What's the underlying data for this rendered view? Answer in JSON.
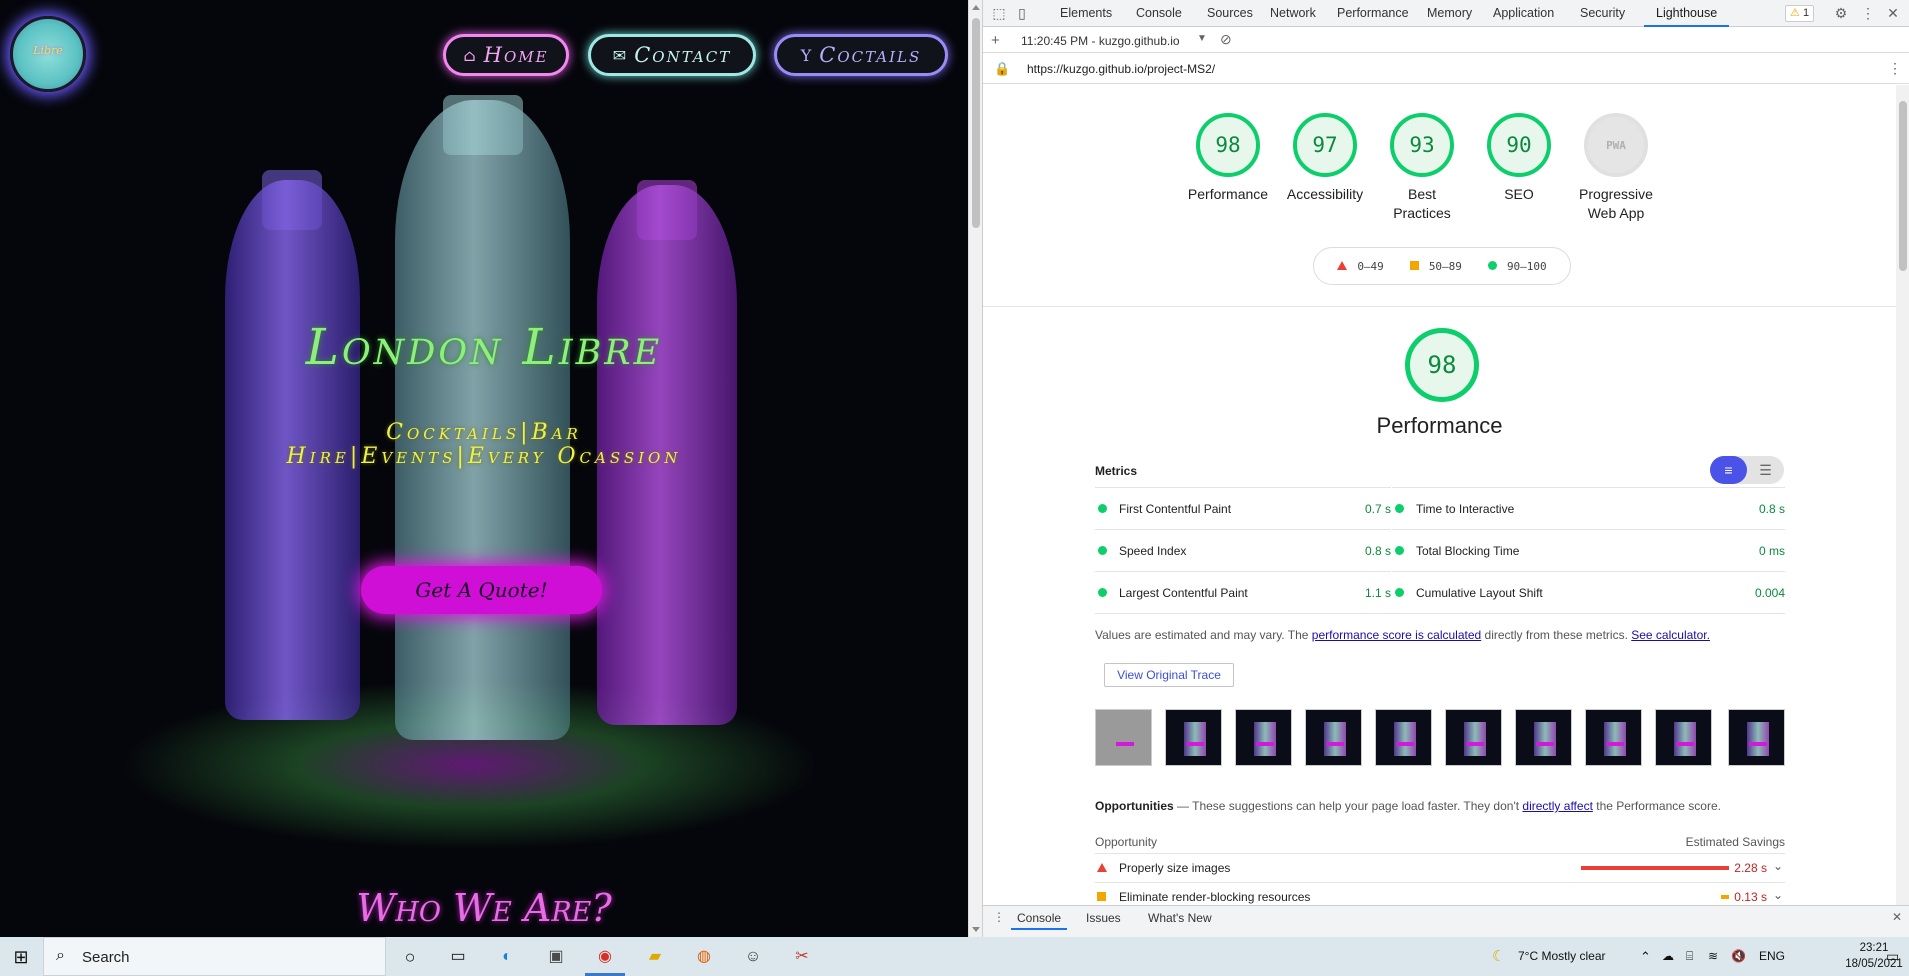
{
  "site": {
    "logo_text": "Libre",
    "nav": [
      {
        "icon": "home-icon",
        "label": "Home"
      },
      {
        "icon": "envelope-icon",
        "label": "Contact"
      },
      {
        "icon": "cocktail-icon",
        "label": "Coctails"
      }
    ],
    "hero_title": "London Libre",
    "hero_sub1": "Cocktails|Bar",
    "hero_sub2": "Hire|Events|Every Ocassion",
    "quote_button": "Get A Quote!",
    "section_title": "Who We Are?"
  },
  "devtools": {
    "tabs": [
      "Elements",
      "Console",
      "Sources",
      "Network",
      "Performance",
      "Memory",
      "Application",
      "Security",
      "Lighthouse"
    ],
    "active_tab": "Lighthouse",
    "warning_count": "1",
    "report_time": "11:20:45 PM - kuzgo.github.io",
    "url": "https://kuzgo.github.io/project-MS2/",
    "drawer_tabs": [
      "Console",
      "Issues",
      "What's New"
    ]
  },
  "lighthouse": {
    "scores": [
      {
        "value": "98",
        "label": "Performance"
      },
      {
        "value": "97",
        "label": "Accessibility"
      },
      {
        "value": "93",
        "label": "Best Practices"
      },
      {
        "value": "90",
        "label": "SEO"
      },
      {
        "value": "PWA",
        "label": "Progressive Web App"
      }
    ],
    "legend": [
      "0–49",
      "50–89",
      "90–100"
    ],
    "performance_score": "98",
    "performance_title": "Performance",
    "metrics_heading": "Metrics",
    "metrics": [
      {
        "name": "First Contentful Paint",
        "value": "0.7 s"
      },
      {
        "name": "Time to Interactive",
        "value": "0.8 s"
      },
      {
        "name": "Speed Index",
        "value": "0.8 s"
      },
      {
        "name": "Total Blocking Time",
        "value": "0 ms"
      },
      {
        "name": "Largest Contentful Paint",
        "value": "1.1 s"
      },
      {
        "name": "Cumulative Layout Shift",
        "value": "0.004"
      }
    ],
    "note_prefix": "Values are estimated and may vary. The ",
    "note_link1": "performance score is calculated",
    "note_middle": " directly from these metrics. ",
    "note_link2": "See calculator.",
    "trace_button": "View Original Trace",
    "opportunities_title": "Opportunities",
    "opportunities_desc_prefix": " — These suggestions can help your page load faster. They don't ",
    "opportunities_link": "directly affect",
    "opportunities_desc_suffix": " the Performance score.",
    "opp_col_left": "Opportunity",
    "opp_col_right": "Estimated Savings",
    "opportunities": [
      {
        "name": "Properly size images",
        "value": "2.28 s",
        "severity": "red",
        "bar_fraction": 1.0
      },
      {
        "name": "Eliminate render-blocking resources",
        "value": "0.13 s",
        "severity": "orange",
        "bar_fraction": 0.057
      }
    ]
  },
  "taskbar": {
    "search_placeholder": "Search",
    "weather": "7°C  Mostly clear",
    "language": "ENG",
    "time": "23:21",
    "date": "18/05/2021"
  },
  "colors": {
    "good": "#0cce6b",
    "average": "#f2a600",
    "poor": "#eb3f36",
    "lighthouse_tab_underline": "#1a73e8",
    "quote_button": "#cf0fd6",
    "hero_title": "#8ef07a"
  }
}
